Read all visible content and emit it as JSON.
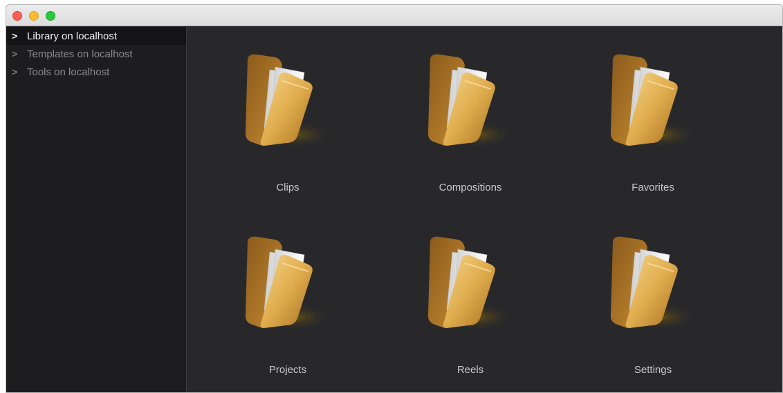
{
  "window": {
    "controls": [
      "close",
      "minimize",
      "maximize"
    ]
  },
  "sidebar": {
    "items": [
      {
        "label": "Library on localhost",
        "selected": true,
        "icon": "chevron-right-icon"
      },
      {
        "label": "Templates on localhost",
        "selected": false,
        "icon": "chevron-right-icon"
      },
      {
        "label": "Tools on localhost",
        "selected": false,
        "icon": "chevron-right-icon"
      }
    ]
  },
  "grid": {
    "items": [
      {
        "label": "Clips",
        "icon": "folder-icon"
      },
      {
        "label": "Compositions",
        "icon": "folder-icon"
      },
      {
        "label": "Favorites",
        "icon": "folder-icon"
      },
      {
        "label": "Projects",
        "icon": "folder-icon"
      },
      {
        "label": "Reels",
        "icon": "folder-icon"
      },
      {
        "label": "Settings",
        "icon": "folder-icon"
      }
    ]
  },
  "colors": {
    "background": "#28282b",
    "sidebar": "#1d1d20",
    "folder_gold": "#d9a94a"
  }
}
